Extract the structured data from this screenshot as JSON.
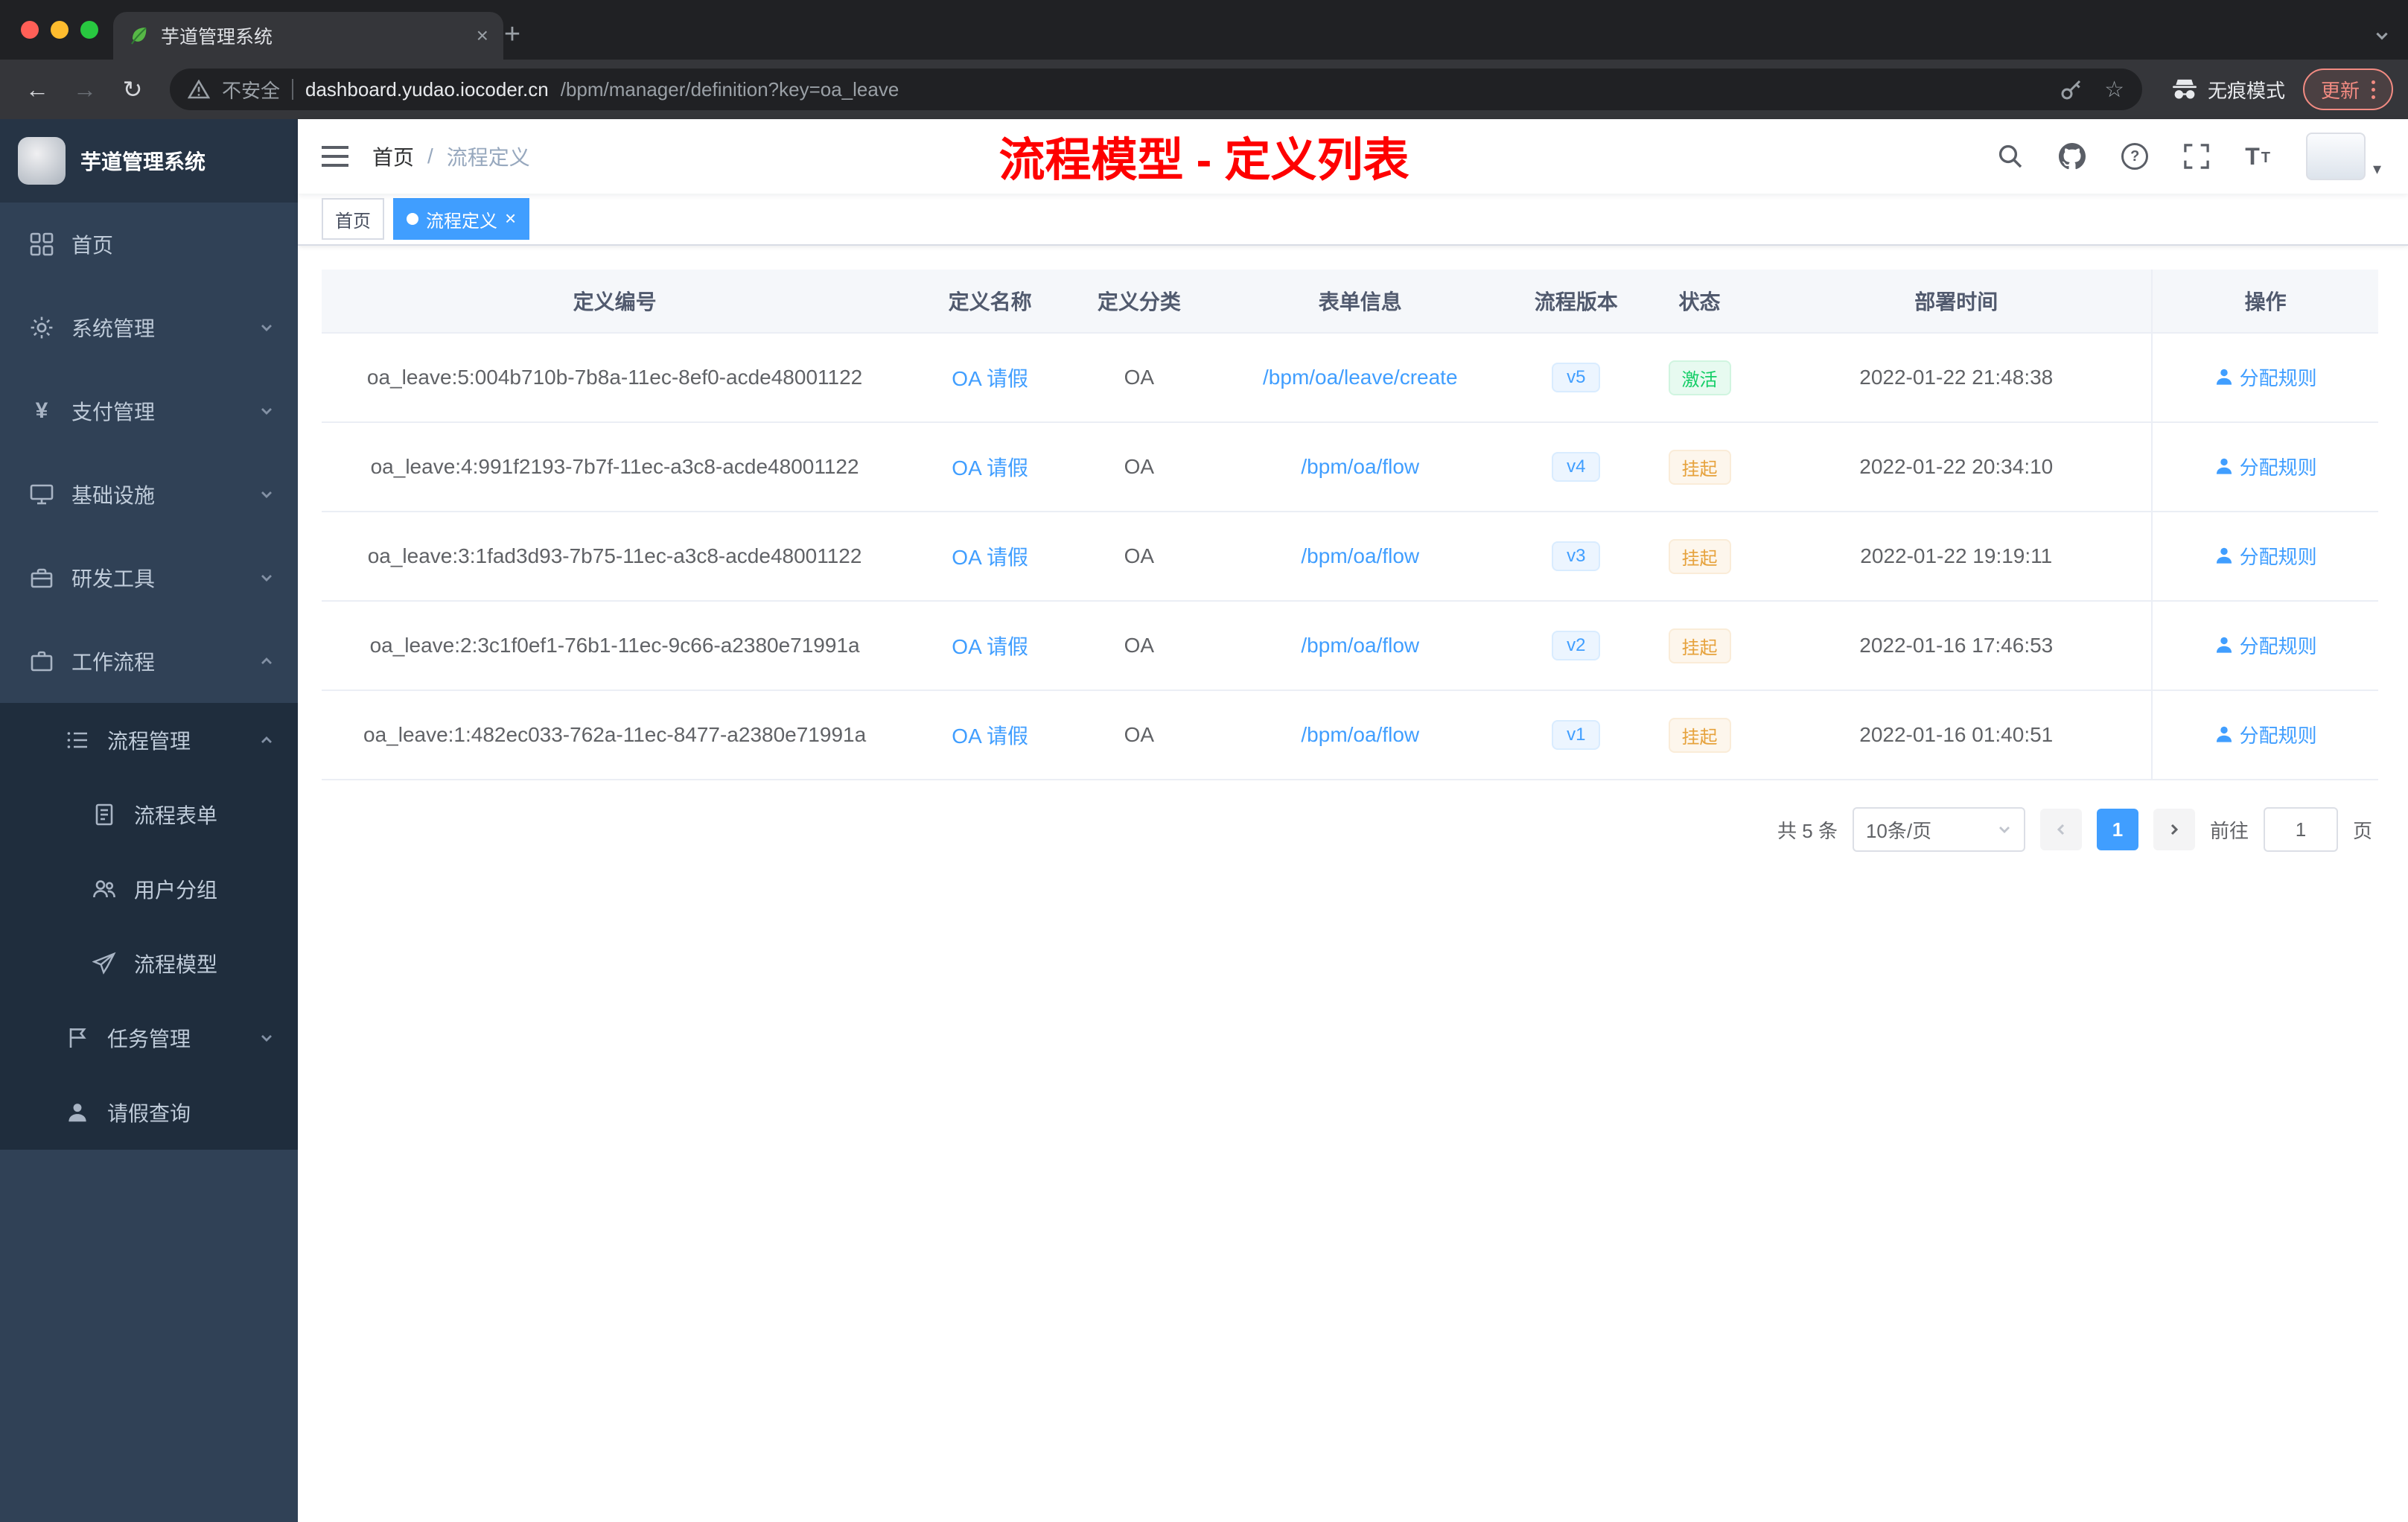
{
  "colors": {
    "accent": "#409eff",
    "success": "#13ce66",
    "warning": "#e6a23c",
    "annotation_red": "#fe0000",
    "sidebar_bg": "#304156",
    "submenu_bg": "#1f2d3d"
  },
  "icons": {
    "tab_favicon": "green-leaf",
    "security": "warning-triangle",
    "incognito": "hat-and-glasses",
    "menu_more": "vertical-dots",
    "close": "×",
    "home": "grid",
    "system": "gear",
    "payment": "¥",
    "infra": "monitor",
    "devtools": "briefcase",
    "workflow": "suitcase",
    "process_mgmt": "list",
    "process_form": "document",
    "user_group": "users",
    "process_model": "paper-plane",
    "task_mgmt": "flag",
    "leave_query": "person",
    "assign_rule": "person",
    "navbar": [
      "search",
      "github",
      "question",
      "fullscreen",
      "font-size"
    ]
  },
  "browser": {
    "tab_title": "芋道管理系统",
    "security_label": "不安全",
    "url_domain": "dashboard.yudao.iocoder.cn",
    "url_path": "/bpm/manager/definition?key=oa_leave",
    "incognito_label": "无痕模式",
    "update_label": "更新"
  },
  "sidebar": {
    "logo_title": "芋道管理系统",
    "menu": {
      "home": "首页",
      "system": "系统管理",
      "payment": "支付管理",
      "infra": "基础设施",
      "devtools": "研发工具",
      "workflow": "工作流程",
      "process_mgmt": "流程管理",
      "process_form": "流程表单",
      "user_group": "用户分组",
      "process_model": "流程模型",
      "task_mgmt": "任务管理",
      "leave_query": "请假查询"
    }
  },
  "header": {
    "breadcrumb_home": "首页",
    "breadcrumb_separator": "/",
    "breadcrumb_current": "流程定义",
    "annotation": "流程模型 - 定义列表"
  },
  "tags": [
    {
      "label": "首页",
      "active": false
    },
    {
      "label": "流程定义",
      "active": true
    }
  ],
  "table": {
    "columns": [
      "定义编号",
      "定义名称",
      "定义分类",
      "表单信息",
      "流程版本",
      "状态",
      "部署时间",
      "操作"
    ],
    "rows": [
      {
        "id": "oa_leave:5:004b710b-7b8a-11ec-8ef0-acde48001122",
        "name": "OA 请假",
        "category": "OA",
        "form": "/bpm/oa/leave/create",
        "version": "v5",
        "status": "激活",
        "time": "2022-01-22 21:48:38",
        "action": "分配规则"
      },
      {
        "id": "oa_leave:4:991f2193-7b7f-11ec-a3c8-acde48001122",
        "name": "OA 请假",
        "category": "OA",
        "form": "/bpm/oa/flow",
        "version": "v4",
        "status": "挂起",
        "time": "2022-01-22 20:34:10",
        "action": "分配规则"
      },
      {
        "id": "oa_leave:3:1fad3d93-7b75-11ec-a3c8-acde48001122",
        "name": "OA 请假",
        "category": "OA",
        "form": "/bpm/oa/flow",
        "version": "v3",
        "status": "挂起",
        "time": "2022-01-22 19:19:11",
        "action": "分配规则"
      },
      {
        "id": "oa_leave:2:3c1f0ef1-76b1-11ec-9c66-a2380e71991a",
        "name": "OA 请假",
        "category": "OA",
        "form": "/bpm/oa/flow",
        "version": "v2",
        "status": "挂起",
        "time": "2022-01-16 17:46:53",
        "action": "分配规则"
      },
      {
        "id": "oa_leave:1:482ec033-762a-11ec-8477-a2380e71991a",
        "name": "OA 请假",
        "category": "OA",
        "form": "/bpm/oa/flow",
        "version": "v1",
        "status": "挂起",
        "time": "2022-01-16 01:40:51",
        "action": "分配规则"
      }
    ]
  },
  "pagination": {
    "total": "共 5 条",
    "page_size": "10条/页",
    "page": "1",
    "goto": "前往",
    "goto_value": "1",
    "unit": "页"
  }
}
